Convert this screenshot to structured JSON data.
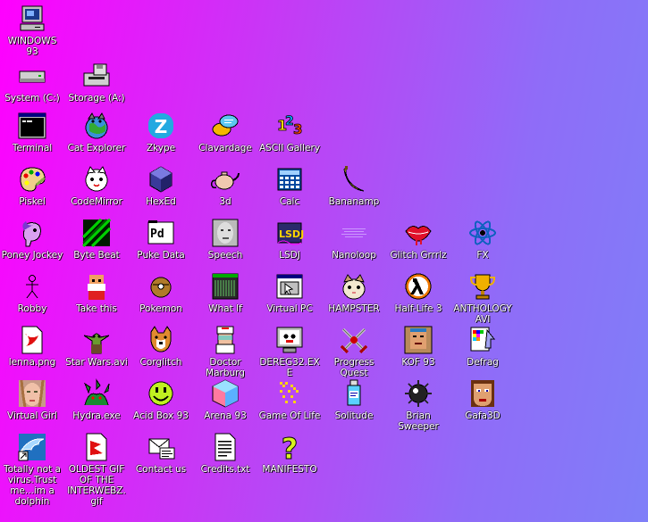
{
  "desktop": {
    "icons": [
      {
        "label": "WINDOWS 93",
        "icon": "computer-icon",
        "name": "desktop-icon-windows93"
      },
      {
        "label": "System (C:)",
        "icon": "hard-drive-icon",
        "name": "desktop-icon-system-c"
      },
      {
        "label": "Storage (A:)",
        "icon": "floppy-drive-icon",
        "name": "desktop-icon-storage-a"
      },
      {
        "label": "Terminal",
        "icon": "terminal-icon",
        "name": "desktop-icon-terminal"
      },
      {
        "label": "Cat Explorer",
        "icon": "cat-globe-icon",
        "name": "desktop-icon-cat-explorer"
      },
      {
        "label": "Zkype",
        "icon": "zkype-icon",
        "name": "desktop-icon-zkype"
      },
      {
        "label": "Clavardage",
        "icon": "chat-bubbles-icon",
        "name": "desktop-icon-clavardage"
      },
      {
        "label": "ASCII Gallery",
        "icon": "numbers-123-icon",
        "name": "desktop-icon-ascii-gallery"
      },
      {
        "label": "Piskel",
        "icon": "palette-icon",
        "name": "desktop-icon-piskel"
      },
      {
        "label": "CodeMirror",
        "icon": "cat-face-icon",
        "name": "desktop-icon-codemirror"
      },
      {
        "label": "HexEd",
        "icon": "cube-icon",
        "name": "desktop-icon-hexed"
      },
      {
        "label": "3d",
        "icon": "teapot-icon",
        "name": "desktop-icon-3d"
      },
      {
        "label": "Calc",
        "icon": "calculator-icon",
        "name": "desktop-icon-calc"
      },
      {
        "label": "Bananamp",
        "icon": "banana-icon",
        "name": "desktop-icon-bananamp"
      },
      {
        "label": "Poney Jockey",
        "icon": "pony-icon",
        "name": "desktop-icon-poney-jockey"
      },
      {
        "label": "Byte Beat",
        "icon": "byte-beat-icon",
        "name": "desktop-icon-byte-beat"
      },
      {
        "label": "Puke Data",
        "icon": "pd-icon",
        "name": "desktop-icon-puke-data"
      },
      {
        "label": "Speech",
        "icon": "face-icon",
        "name": "desktop-icon-speech"
      },
      {
        "label": "LSDJ",
        "icon": "lsdj-icon",
        "name": "desktop-icon-lsdj"
      },
      {
        "label": "Nanoloop",
        "icon": "nanoloop-icon",
        "name": "desktop-icon-nanoloop"
      },
      {
        "label": "Glitch Grrrlz",
        "icon": "lips-icon",
        "name": "desktop-icon-glitch-grrrlz"
      },
      {
        "label": "FX",
        "icon": "atom-icon",
        "name": "desktop-icon-fx"
      },
      {
        "label": "Robby",
        "icon": "stick-figure-icon",
        "name": "desktop-icon-robby"
      },
      {
        "label": "Take this",
        "icon": "old-man-icon",
        "name": "desktop-icon-take-this"
      },
      {
        "label": "Pokemon",
        "icon": "pokeball-icon",
        "name": "desktop-icon-pokemon"
      },
      {
        "label": "What If",
        "icon": "what-if-window-icon",
        "name": "desktop-icon-what-if"
      },
      {
        "label": "Virtual PC",
        "icon": "window-app-icon",
        "name": "desktop-icon-virtual-pc"
      },
      {
        "label": "HAMPSTER",
        "icon": "hamster-icon",
        "name": "desktop-icon-hampster"
      },
      {
        "label": "Half-Life 3",
        "icon": "lambda-icon",
        "name": "desktop-icon-half-life-3"
      },
      {
        "label": "ANTHOLOGY AVI",
        "icon": "trophy-icon",
        "name": "desktop-icon-anthology-avi"
      },
      {
        "label": "lenna.png",
        "icon": "image-file-icon",
        "name": "desktop-icon-lenna-png"
      },
      {
        "label": "Star Wars.avi",
        "icon": "yoda-icon",
        "name": "desktop-icon-star-wars-avi"
      },
      {
        "label": "Corglitch",
        "icon": "corgi-icon",
        "name": "desktop-icon-corglitch"
      },
      {
        "label": "Doctor Marburg",
        "icon": "doctor-icon",
        "name": "desktop-icon-doctor-marburg"
      },
      {
        "label": "DEREG32.EXE",
        "icon": "monitor-face-icon",
        "name": "desktop-icon-dereg32-exe"
      },
      {
        "label": "Progress Quest",
        "icon": "crossed-swords-icon",
        "name": "desktop-icon-progress-quest"
      },
      {
        "label": "KOF 93",
        "icon": "fighter-icon",
        "name": "desktop-icon-kof-93"
      },
      {
        "label": "Defrag",
        "icon": "defrag-icon",
        "name": "desktop-icon-defrag"
      },
      {
        "label": "Virtual Girl",
        "icon": "girl-face-icon",
        "name": "desktop-icon-virtual-girl"
      },
      {
        "label": "Hydra.exe",
        "icon": "hydra-icon",
        "name": "desktop-icon-hydra-exe"
      },
      {
        "label": "Acid Box 93",
        "icon": "smiley-icon",
        "name": "desktop-icon-acid-box-93"
      },
      {
        "label": "Arena 93",
        "icon": "arena-cube-icon",
        "name": "desktop-icon-arena-93"
      },
      {
        "label": "Game Of Life",
        "icon": "game-of-life-icon",
        "name": "desktop-icon-game-of-life"
      },
      {
        "label": "Solitude",
        "icon": "bottle-icon",
        "name": "desktop-icon-solitude"
      },
      {
        "label": "Brian Sweeper",
        "icon": "mine-icon",
        "name": "desktop-icon-brian-sweeper"
      },
      {
        "label": "Gafa3D",
        "icon": "doom-face-icon",
        "name": "desktop-icon-gafa3d"
      },
      {
        "label": "Totally not a virus.Trust me...im a dolphin",
        "icon": "dolphin-shortcut-icon",
        "name": "desktop-icon-dolphin"
      },
      {
        "label": "OLDEST GIF OF THE INTERWEBZ.gif",
        "icon": "gif-file-icon",
        "name": "desktop-icon-oldest-gif"
      },
      {
        "label": "Contact us",
        "icon": "contact-icon",
        "name": "desktop-icon-contact-us"
      },
      {
        "label": "Credits.txt",
        "icon": "text-file-icon",
        "name": "desktop-icon-credits-txt"
      },
      {
        "label": "MANIFESTO",
        "icon": "question-mark-icon",
        "name": "desktop-icon-manifesto"
      }
    ]
  }
}
